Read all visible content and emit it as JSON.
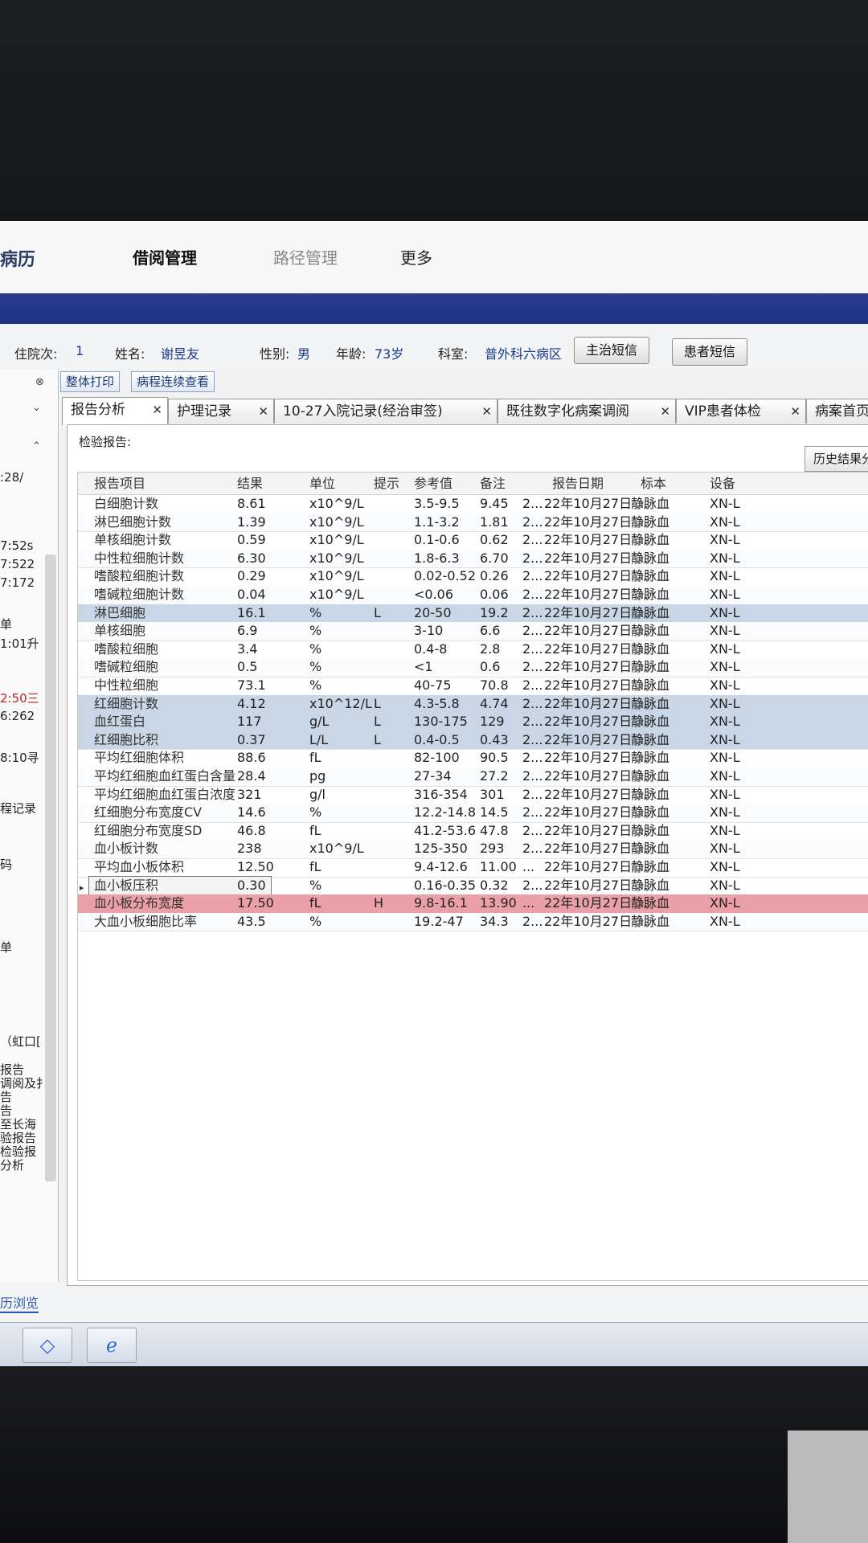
{
  "nav": {
    "brand": "病历",
    "borrow_mgmt": "借阅管理",
    "path_mgmt": "路径管理",
    "more": "更多"
  },
  "patient": {
    "admission_label": "住院次:",
    "admission_value": "1",
    "name_label": "姓名:",
    "name_value": "谢昱友",
    "gender_label": "性别:",
    "gender_value": "男",
    "age_label": "年龄:",
    "age_value": "73岁",
    "dept_label": "科室:",
    "dept_value": "普外科六病区",
    "btn_doctor_sms": "主治短信",
    "btn_patient_sms": "患者短信"
  },
  "sidebar": {
    "fragments": [
      ":28/",
      "7:52s",
      "7:522",
      "7:172",
      "单",
      "1:01升",
      "2:50三",
      "6:262",
      "8:10寻",
      "程记录",
      "码",
      "单",
      "（虹口[",
      "报告",
      "调阅及扌",
      "告",
      "告",
      "至长海",
      "验报告",
      "检验报",
      "分析"
    ]
  },
  "toolbar": {
    "print_all": "整体打印",
    "course_view": "病程连续查看"
  },
  "tabs": [
    {
      "label": "报告分析"
    },
    {
      "label": "护理记录"
    },
    {
      "label": "10-27入院记录(经治审签)"
    },
    {
      "label": "既往数字化病案调阅"
    },
    {
      "label": "VIP患者体检"
    },
    {
      "label": "病案首页"
    }
  ],
  "report": {
    "label": "检验报告:",
    "history_btn": "历史结果分"
  },
  "grid": {
    "headers": {
      "name": "报告项目",
      "result": "结果",
      "unit": "单位",
      "flag": "提示",
      "ref": "参考值",
      "note": "备注",
      "date": "报告日期",
      "specimen": "标本",
      "device": "设备"
    },
    "rows": [
      {
        "name": "白细胞计数",
        "result": "8.61",
        "unit": "x10^9/L",
        "flag": "",
        "ref": "3.5-9.5",
        "note": "9.45",
        "extra": "2...",
        "date": "22年10月27日 ...",
        "specimen": "静脉血",
        "device": "XN-L"
      },
      {
        "name": "淋巴细胞计数",
        "result": "1.39",
        "unit": "x10^9/L",
        "flag": "",
        "ref": "1.1-3.2",
        "note": "1.81",
        "extra": "2...",
        "date": "22年10月27日 ...",
        "specimen": "静脉血",
        "device": "XN-L"
      },
      {
        "name": "单核细胞计数",
        "result": "0.59",
        "unit": "x10^9/L",
        "flag": "",
        "ref": "0.1-0.6",
        "note": "0.62",
        "extra": "2...",
        "date": "22年10月27日 ...",
        "specimen": "静脉血",
        "device": "XN-L"
      },
      {
        "name": "中性粒细胞计数",
        "result": "6.30",
        "unit": "x10^9/L",
        "flag": "",
        "ref": "1.8-6.3",
        "note": "6.70",
        "extra": "2...",
        "date": "22年10月27日 ...",
        "specimen": "静脉血",
        "device": "XN-L"
      },
      {
        "name": "嗜酸粒细胞计数",
        "result": "0.29",
        "unit": "x10^9/L",
        "flag": "",
        "ref": "0.02-0.52",
        "note": "0.26",
        "extra": "2...",
        "date": "22年10月27日 ...",
        "specimen": "静脉血",
        "device": "XN-L"
      },
      {
        "name": "嗜碱粒细胞计数",
        "result": "0.04",
        "unit": "x10^9/L",
        "flag": "",
        "ref": "<0.06",
        "note": "0.06",
        "extra": "2...",
        "date": "22年10月27日 ...",
        "specimen": "静脉血",
        "device": "XN-L"
      },
      {
        "name": "淋巴细胞",
        "result": "16.1",
        "unit": "%",
        "flag": "L",
        "ref": "20-50",
        "note": "19.2",
        "extra": "2...",
        "date": "22年10月27日 ...",
        "specimen": "静脉血",
        "device": "XN-L",
        "state": "low"
      },
      {
        "name": "单核细胞",
        "result": "6.9",
        "unit": "%",
        "flag": "",
        "ref": "3-10",
        "note": "6.6",
        "extra": "2...",
        "date": "22年10月27日 ...",
        "specimen": "静脉血",
        "device": "XN-L"
      },
      {
        "name": "嗜酸粒细胞",
        "result": "3.4",
        "unit": "%",
        "flag": "",
        "ref": "0.4-8",
        "note": "2.8",
        "extra": "2...",
        "date": "22年10月27日 ...",
        "specimen": "静脉血",
        "device": "XN-L"
      },
      {
        "name": "嗜碱粒细胞",
        "result": "0.5",
        "unit": "%",
        "flag": "",
        "ref": "<1",
        "note": "0.6",
        "extra": "2...",
        "date": "22年10月27日 ...",
        "specimen": "静脉血",
        "device": "XN-L"
      },
      {
        "name": "中性粒细胞",
        "result": "73.1",
        "unit": "%",
        "flag": "",
        "ref": "40-75",
        "note": "70.8",
        "extra": "2...",
        "date": "22年10月27日 ...",
        "specimen": "静脉血",
        "device": "XN-L"
      },
      {
        "name": "红细胞计数",
        "result": "4.12",
        "unit": "x10^12/L",
        "flag": "L",
        "ref": "4.3-5.8",
        "note": "4.74",
        "extra": "2...",
        "date": "22年10月27日 ...",
        "specimen": "静脉血",
        "device": "XN-L",
        "state": "low"
      },
      {
        "name": "血红蛋白",
        "result": "117",
        "unit": "g/L",
        "flag": "L",
        "ref": "130-175",
        "note": "129",
        "extra": "2...",
        "date": "22年10月27日 ...",
        "specimen": "静脉血",
        "device": "XN-L",
        "state": "low"
      },
      {
        "name": "红细胞比积",
        "result": "0.37",
        "unit": "L/L",
        "flag": "L",
        "ref": "0.4-0.5",
        "note": "0.43",
        "extra": "2...",
        "date": "22年10月27日 ...",
        "specimen": "静脉血",
        "device": "XN-L",
        "state": "low"
      },
      {
        "name": "平均红细胞体积",
        "result": "88.6",
        "unit": "fL",
        "flag": "",
        "ref": "82-100",
        "note": "90.5",
        "extra": "2...",
        "date": "22年10月27日 ...",
        "specimen": "静脉血",
        "device": "XN-L"
      },
      {
        "name": "平均红细胞血红蛋白含量",
        "result": "28.4",
        "unit": "pg",
        "flag": "",
        "ref": "27-34",
        "note": "27.2",
        "extra": "2...",
        "date": "22年10月27日 ...",
        "specimen": "静脉血",
        "device": "XN-L"
      },
      {
        "name": "平均红细胞血红蛋白浓度",
        "result": "321",
        "unit": "g/l",
        "flag": "",
        "ref": "316-354",
        "note": "301",
        "extra": "2...",
        "date": "22年10月27日 ...",
        "specimen": "静脉血",
        "device": "XN-L"
      },
      {
        "name": "红细胞分布宽度CV",
        "result": "14.6",
        "unit": "%",
        "flag": "",
        "ref": "12.2-14.8",
        "note": "14.5",
        "extra": "2...",
        "date": "22年10月27日 ...",
        "specimen": "静脉血",
        "device": "XN-L"
      },
      {
        "name": "红细胞分布宽度SD",
        "result": "46.8",
        "unit": "fL",
        "flag": "",
        "ref": "41.2-53.6",
        "note": "47.8",
        "extra": "2...",
        "date": "22年10月27日 ...",
        "specimen": "静脉血",
        "device": "XN-L"
      },
      {
        "name": "血小板计数",
        "result": "238",
        "unit": "x10^9/L",
        "flag": "",
        "ref": "125-350",
        "note": "293",
        "extra": "2...",
        "date": "22年10月27日 ...",
        "specimen": "静脉血",
        "device": "XN-L"
      },
      {
        "name": "平均血小板体积",
        "result": "12.50",
        "unit": "fL",
        "flag": "",
        "ref": "9.4-12.6",
        "note": "11.00",
        "extra": "...",
        "date": "22年10月27日 ...",
        "specimen": "静脉血",
        "device": "XN-L"
      },
      {
        "name": "血小板压积",
        "result": "0.30",
        "unit": "%",
        "flag": "",
        "ref": "0.16-0.35",
        "note": "0.32",
        "extra": "2...",
        "date": "22年10月27日 ...",
        "specimen": "静脉血",
        "device": "XN-L",
        "state": "selected"
      },
      {
        "name": "血小板分布宽度",
        "result": "17.50",
        "unit": "fL",
        "flag": "H",
        "ref": "9.8-16.1",
        "note": "13.90",
        "extra": "...",
        "date": "22年10月27日 ...",
        "specimen": "静脉血",
        "device": "XN-L",
        "state": "high"
      },
      {
        "name": "大血小板细胞比率",
        "result": "43.5",
        "unit": "%",
        "flag": "",
        "ref": "19.2-47",
        "note": "34.3",
        "extra": "2...",
        "date": "22年10月27日 ...",
        "specimen": "静脉血",
        "device": "XN-L"
      }
    ]
  },
  "taskbar": {
    "label": "历浏览"
  },
  "colors": {
    "low_row": "#c8d6e6",
    "high_row": "#eaa0a6",
    "header_bar": "#1e3080"
  }
}
